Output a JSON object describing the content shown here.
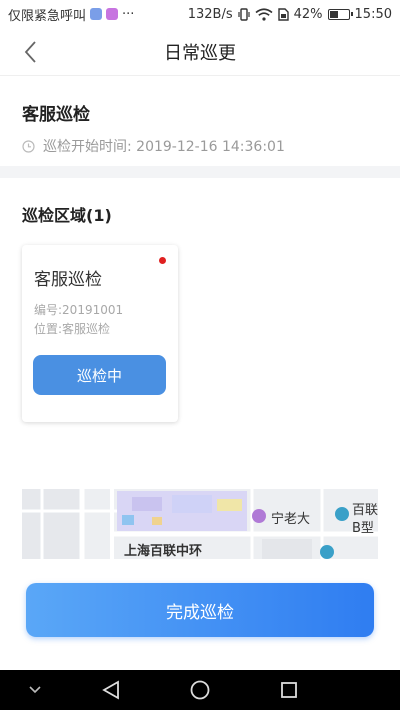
{
  "status_bar": {
    "carrier_text": "仅限紧急呼叫",
    "more": "···",
    "speed": "132B/s",
    "battery_percent": "42%",
    "battery_level": 0.42,
    "time": "15:50",
    "icons": [
      "shield-icon",
      "app-icon",
      "vibrate-icon",
      "wifi-icon",
      "sim-icon",
      "battery-icon"
    ]
  },
  "nav": {
    "title": "日常巡更"
  },
  "patrol": {
    "title": "客服巡检",
    "start_time_label": "巡检开始时间: 2019-12-16 14:36:01"
  },
  "area": {
    "title": "巡检区域(1)",
    "cards": [
      {
        "name": "客服巡检",
        "code": "编号:20191001",
        "location": "位置:客服巡检",
        "button_label": "巡检中",
        "status_color": "#e02020"
      }
    ]
  },
  "map": {
    "labels": [
      "宁老大",
      "百联",
      "B型",
      "上海百联中环"
    ]
  },
  "footer": {
    "complete_label": "完成巡检"
  },
  "colors": {
    "accent": "#4a90e2",
    "primary_button": "#2f7df1"
  }
}
